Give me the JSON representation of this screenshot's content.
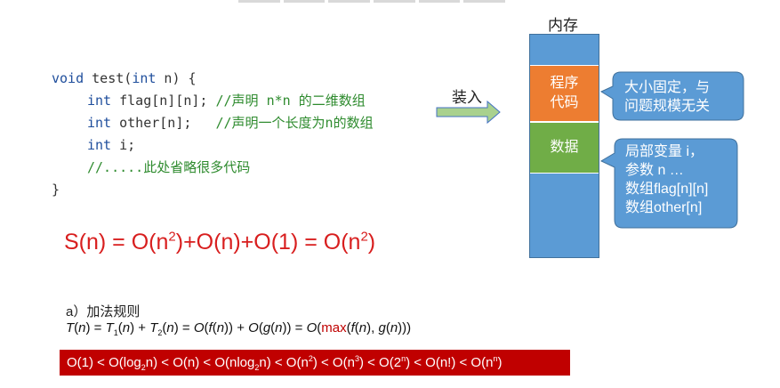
{
  "code": {
    "line1": {
      "type": "void",
      "name": " test(",
      "param_type": "int",
      "param": " n) {"
    },
    "line2": {
      "type": "int",
      "decl": " flag[n][n]; ",
      "comment": "//声明 n*n 的二维数组"
    },
    "line3": {
      "type": "int",
      "decl": " other[n];   ",
      "comment": "//声明一个长度为n的数组"
    },
    "line4": {
      "type": "int",
      "decl": " i;"
    },
    "line5": {
      "comment": "//.....此处省略很多代码"
    },
    "line6": {
      "text": "}"
    }
  },
  "space_formula": {
    "part1": "S(n) = O(n",
    "exp1": "2",
    "part2": ")+O(n)+O(1) = O(n",
    "exp2": "2",
    "part3": ")"
  },
  "arrow_label": "装入",
  "memory": {
    "title": "内存",
    "program_line1": "程序",
    "program_line2": "代码",
    "data_label": "数据"
  },
  "callouts": {
    "program_line1": "大小固定，与",
    "program_line2": "问题规模无关",
    "data_line1": "局部变量 i，",
    "data_line2": "参数 n …",
    "data_line3": "数组flag[n][n]",
    "data_line4": "数组other[n]"
  },
  "rule": {
    "title": "a）加法规则",
    "t": "T",
    "t1": "T",
    "t1_sub": "1",
    "t2": "T",
    "t2_sub": "2",
    "n": "n",
    "f": "f",
    "g": "g",
    "o": "O",
    "max": "max"
  },
  "order": {
    "o1": "O(1) < O(log",
    "o1_sub": "2",
    "o2": "n) < O(n) < O(nlog",
    "o2_sub": "2",
    "o3": "n) < O(n",
    "o3_sup": "2",
    "o4": ") < O(n",
    "o4_sup": "3",
    "o5": ") < O(2",
    "o5_sup": "n",
    "o6": ") < O(n!) < O(n",
    "o6_sup": "n",
    "o7": ")"
  },
  "colors": {
    "memory_blue": "#5b9bd5",
    "program_orange": "#ed7d31",
    "data_green": "#70ad47",
    "formula_red": "#d81e1e",
    "order_bar_red": "#c00000"
  }
}
